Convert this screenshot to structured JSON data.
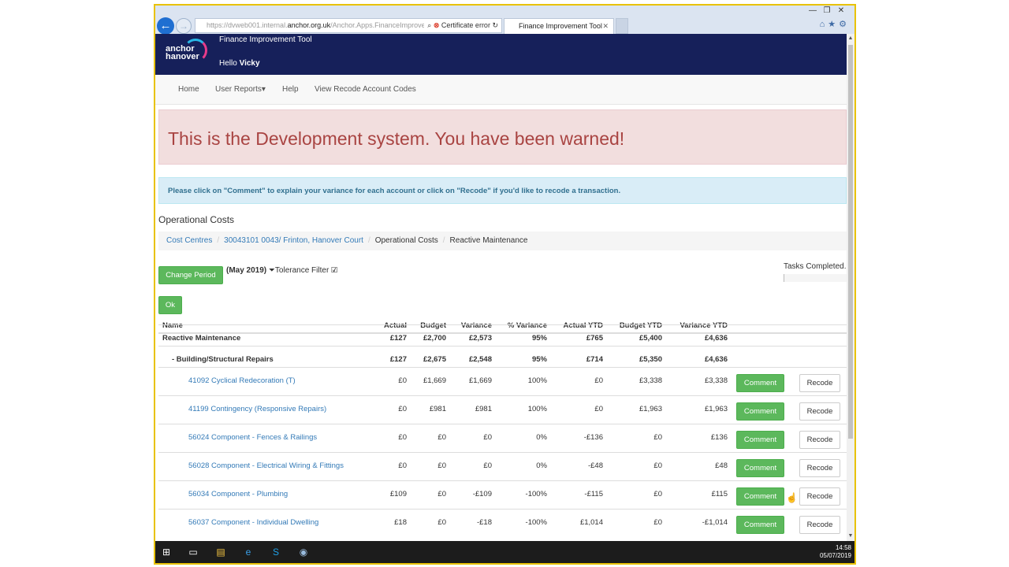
{
  "browser": {
    "url_prefix": "https://dvweb001.internal.",
    "url_domain": "anchor.org.uk",
    "url_path": "/Anchor.Apps.FinanceImprove",
    "cert_error": "Certificate error",
    "tab_title": "Finance Improvement Tool",
    "tab_close": "✕",
    "win_controls": [
      "—",
      "❐",
      "✕"
    ],
    "fav_icons": "⌂★⚙"
  },
  "header": {
    "logo_line1": "anchor",
    "logo_line2": "hanover",
    "app_title": "Finance Improvement Tool",
    "hello_prefix": "Hello",
    "user": "Vicky"
  },
  "nav": {
    "home": "Home",
    "user_reports": "User Reports▾",
    "help": "Help",
    "view_recode": "View Recode Account Codes"
  },
  "alerts": {
    "danger": "This is the Development system. You have been warned!",
    "info": "Please click on \"Comment\" to explain your variance for each account or click on \"Recode\" if you'd like to recode a transaction."
  },
  "section_title": "Operational Costs",
  "breadcrumb": {
    "items": [
      "Cost Centres",
      "30043101 0043/ Frinton, Hanover Court",
      "Operational Costs",
      "Reactive Maintenance"
    ],
    "separator": "/"
  },
  "controls": {
    "change_period": "Change Period",
    "period": "(May 2019)",
    "tolerance": "Tolerance Filter",
    "checkbox": "☑",
    "filter_icon": "⏷",
    "ok": "Ok",
    "tasks_completed": "Tasks Completed."
  },
  "table": {
    "headers": [
      "Name",
      "Actual",
      "Budget",
      "Variance",
      "% Variance",
      "Actual YTD",
      "Budget YTD",
      "Variance YTD"
    ],
    "rows": [
      {
        "name": "Reactive Maintenance",
        "actual": "£127",
        "budget": "£2,700",
        "variance": "£2,573",
        "pct": "95%",
        "ytd": "£765",
        "bytd": "£5,400",
        "vytd": "£4,636"
      },
      {
        "name": "- Building/Structural Repairs",
        "actual": "£127",
        "budget": "£2,675",
        "variance": "£2,548",
        "pct": "95%",
        "ytd": "£714",
        "bytd": "£5,350",
        "vytd": "£4,636"
      },
      {
        "name": "41092 Cyclical Redecoration (T)",
        "actual": "£0",
        "budget": "£1,669",
        "variance": "£1,669",
        "pct": "100%",
        "ytd": "£0",
        "bytd": "£3,338",
        "vytd": "£3,338"
      },
      {
        "name": "41199 Contingency (Responsive Repairs)",
        "actual": "£0",
        "budget": "£981",
        "variance": "£981",
        "pct": "100%",
        "ytd": "£0",
        "bytd": "£1,963",
        "vytd": "£1,963"
      },
      {
        "name": "56024 Component - Fences & Railings",
        "actual": "£0",
        "budget": "£0",
        "variance": "£0",
        "pct": "0%",
        "ytd": "-£136",
        "bytd": "£0",
        "vytd": "£136"
      },
      {
        "name": "56028 Component - Electrical Wiring & Fittings",
        "actual": "£0",
        "budget": "£0",
        "variance": "£0",
        "pct": "0%",
        "ytd": "-£48",
        "bytd": "£0",
        "vytd": "£48"
      },
      {
        "name": "56034 Component - Plumbing",
        "actual": "£109",
        "budget": "£0",
        "variance": "-£109",
        "pct": "-100%",
        "ytd": "-£115",
        "bytd": "£0",
        "vytd": "£115"
      },
      {
        "name": "56037 Component - Individual Dwelling",
        "actual": "£18",
        "budget": "£0",
        "variance": "-£18",
        "pct": "-100%",
        "ytd": "£1,014",
        "bytd": "£0",
        "vytd": "-£1,014"
      }
    ],
    "comment_label": "Comment",
    "recode_label": "Recode"
  },
  "taskbar": {
    "time": "14:58",
    "date": "05/07/2019",
    "icons": [
      "⊞",
      "▭",
      "▤",
      "e",
      "S",
      "◉"
    ]
  },
  "colors": {
    "header_bg": "#16205a",
    "primary_green": "#5cb85c",
    "link_blue": "#337ab7",
    "danger_text": "#a94442",
    "info_text": "#31708f"
  }
}
